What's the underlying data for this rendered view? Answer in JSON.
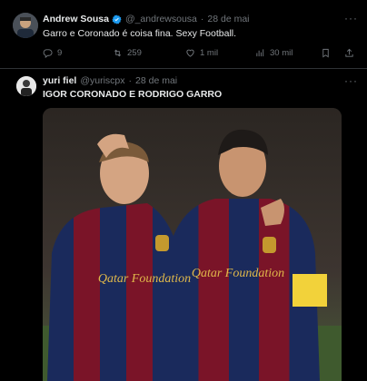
{
  "tweet1": {
    "display_name": "Andrew Sousa",
    "handle": "@_andrewsousa",
    "date": "28 de mai",
    "separator": "·",
    "text": "Garro e Coronado é coisa fina. Sexy Football.",
    "replies": "9",
    "retweets": "259",
    "likes": "1 mil",
    "views": "30 mil",
    "verified_color": "#1d9bf0"
  },
  "tweet2": {
    "display_name": "yuri fiel",
    "handle": "@yuriscpx",
    "date": "28 de mai",
    "separator": "·",
    "text": "IGOR CORONADO E RODRIGO GARRO",
    "image": {
      "shirt_sponsor_left": "Qatar Foundation",
      "shirt_sponsor_right": "Qatar Foundation"
    }
  },
  "more_label": "···"
}
